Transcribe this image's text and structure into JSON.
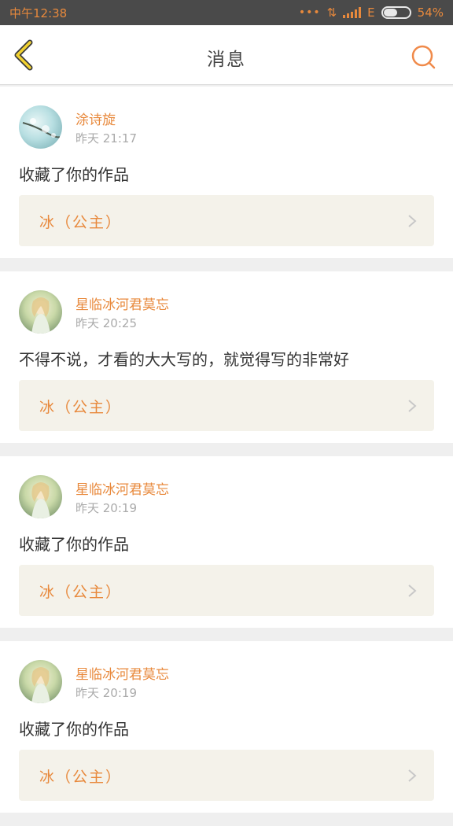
{
  "status_bar": {
    "time": "中午12:38",
    "network": "E",
    "battery": "54%",
    "battery_level": 0.54
  },
  "nav": {
    "title": "消息",
    "back_icon": "chevron-left-icon",
    "search_icon": "search-icon"
  },
  "accent_color": "#e8893c",
  "messages": [
    {
      "user": "涂诗旋",
      "time": "昨天  21:17",
      "text": "收藏了你的作品",
      "work": "冰（公主）"
    },
    {
      "user": "星临冰河君莫忘",
      "time": "昨天  20:25",
      "text": "不得不说，才看的大大写的，就觉得写的非常好",
      "work": "冰（公主）"
    },
    {
      "user": "星临冰河君莫忘",
      "time": "昨天  20:19",
      "text": "收藏了你的作品",
      "work": "冰（公主）"
    },
    {
      "user": "星临冰河君莫忘",
      "time": "昨天  20:19",
      "text": "收藏了你的作品",
      "work": "冰（公主）"
    }
  ]
}
